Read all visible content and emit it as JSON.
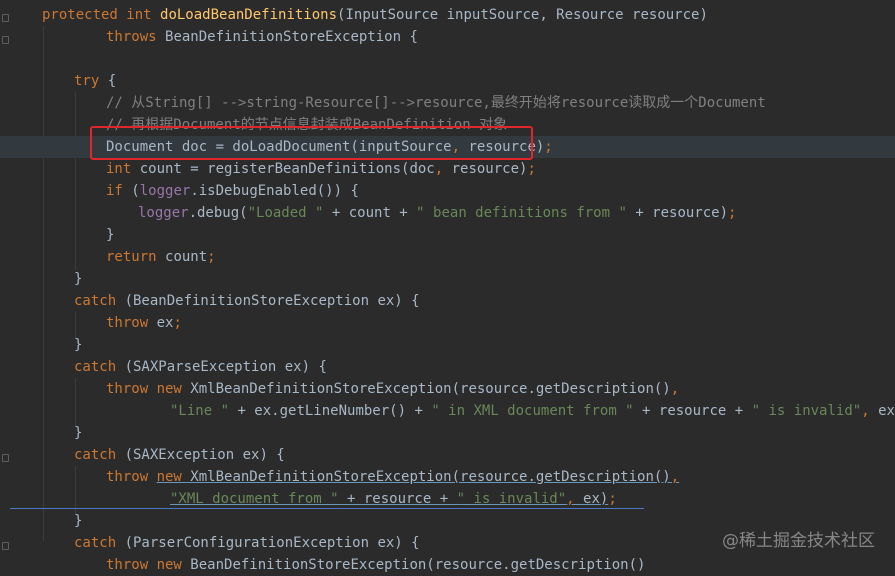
{
  "editor": {
    "lines": [
      {
        "indent": 42,
        "tokens": [
          {
            "t": "protected int ",
            "c": "kw"
          },
          {
            "t": "doLoadBeanDefinitions",
            "c": "fn"
          },
          {
            "t": "(InputSource inputSource, Resource resource)",
            "c": ""
          }
        ]
      },
      {
        "indent": 106,
        "tokens": [
          {
            "t": "throws ",
            "c": "kw"
          },
          {
            "t": "BeanDefinitionStoreException {",
            "c": ""
          }
        ]
      },
      {
        "indent": 0,
        "tokens": []
      },
      {
        "indent": 74,
        "tokens": [
          {
            "t": "try ",
            "c": "kw"
          },
          {
            "t": "{",
            "c": ""
          }
        ]
      },
      {
        "indent": 106,
        "tokens": [
          {
            "t": "// 从String[] -->string-Resource[]-->resource,最终开始将resource读取成一个Document",
            "c": "cmt"
          }
        ]
      },
      {
        "indent": 106,
        "tokens": [
          {
            "t": "// 再根据Document的节点信息封装成BeanDefinition 对象",
            "c": "cmt"
          }
        ]
      },
      {
        "indent": 106,
        "current": true,
        "tokens": [
          {
            "t": "Document doc = doLoadDocument(inputSource",
            "c": ""
          },
          {
            "t": ", ",
            "c": "kw"
          },
          {
            "t": "resource)",
            "c": ""
          },
          {
            "t": ";",
            "c": "kw"
          }
        ]
      },
      {
        "indent": 106,
        "tokens": [
          {
            "t": "int ",
            "c": "kw"
          },
          {
            "t": "count = registerBeanDefinitions(doc",
            "c": ""
          },
          {
            "t": ", ",
            "c": "kw"
          },
          {
            "t": "resource)",
            "c": ""
          },
          {
            "t": ";",
            "c": "kw"
          }
        ]
      },
      {
        "indent": 106,
        "tokens": [
          {
            "t": "if ",
            "c": "kw"
          },
          {
            "t": "(",
            "c": ""
          },
          {
            "t": "logger",
            "c": "fld"
          },
          {
            "t": ".isDebugEnabled()) {",
            "c": ""
          }
        ]
      },
      {
        "indent": 138,
        "tokens": [
          {
            "t": "logger",
            "c": "fld"
          },
          {
            "t": ".debug(",
            "c": ""
          },
          {
            "t": "\"Loaded \"",
            "c": "str"
          },
          {
            "t": " + count + ",
            "c": ""
          },
          {
            "t": "\" bean definitions from \"",
            "c": "str"
          },
          {
            "t": " + resource)",
            "c": ""
          },
          {
            "t": ";",
            "c": "kw"
          }
        ]
      },
      {
        "indent": 106,
        "tokens": [
          {
            "t": "}",
            "c": ""
          }
        ]
      },
      {
        "indent": 106,
        "tokens": [
          {
            "t": "return ",
            "c": "kw"
          },
          {
            "t": "count",
            "c": ""
          },
          {
            "t": ";",
            "c": "kw"
          }
        ]
      },
      {
        "indent": 74,
        "tokens": [
          {
            "t": "}",
            "c": ""
          }
        ]
      },
      {
        "indent": 74,
        "tokens": [
          {
            "t": "catch ",
            "c": "kw"
          },
          {
            "t": "(BeanDefinitionStoreException ex) {",
            "c": ""
          }
        ]
      },
      {
        "indent": 106,
        "tokens": [
          {
            "t": "throw ",
            "c": "kw"
          },
          {
            "t": "ex",
            "c": ""
          },
          {
            "t": ";",
            "c": "kw"
          }
        ]
      },
      {
        "indent": 74,
        "tokens": [
          {
            "t": "}",
            "c": ""
          }
        ]
      },
      {
        "indent": 74,
        "tokens": [
          {
            "t": "catch ",
            "c": "kw"
          },
          {
            "t": "(SAXParseException ex) {",
            "c": ""
          }
        ]
      },
      {
        "indent": 106,
        "tokens": [
          {
            "t": "throw new ",
            "c": "kw"
          },
          {
            "t": "XmlBeanDefinitionStoreException(resource.getDescription()",
            "c": ""
          },
          {
            "t": ",",
            "c": "kw"
          }
        ]
      },
      {
        "indent": 170,
        "tokens": [
          {
            "t": "\"Line \"",
            "c": "str"
          },
          {
            "t": " + ex.getLineNumber() + ",
            "c": ""
          },
          {
            "t": "\" in XML document from \"",
            "c": "str"
          },
          {
            "t": " + resource + ",
            "c": ""
          },
          {
            "t": "\" is invalid\"",
            "c": "str"
          },
          {
            "t": ", ",
            "c": "kw"
          },
          {
            "t": "ex)",
            "c": ""
          },
          {
            "t": ";",
            "c": "kw"
          }
        ]
      },
      {
        "indent": 74,
        "tokens": [
          {
            "t": "}",
            "c": ""
          }
        ]
      },
      {
        "indent": 74,
        "tokens": [
          {
            "t": "catch ",
            "c": "kw"
          },
          {
            "t": "(SAXException ex) {",
            "c": ""
          }
        ]
      },
      {
        "indent": 106,
        "tokens": [
          {
            "t": "throw ",
            "c": "kw"
          },
          {
            "t": "new ",
            "c": "kw link"
          },
          {
            "t": "XmlBeanDefinitionStoreException(resource.getDescription()",
            "c": "link"
          },
          {
            "t": ",",
            "c": "kw link"
          }
        ]
      },
      {
        "indent": 170,
        "tokens": [
          {
            "t": "\"XML document from \"",
            "c": "str link"
          },
          {
            "t": " + resource + ",
            "c": "link"
          },
          {
            "t": "\" is invalid\"",
            "c": "str link"
          },
          {
            "t": ", ",
            "c": "kw link"
          },
          {
            "t": "ex)",
            "c": "link"
          },
          {
            "t": ";",
            "c": "kw"
          }
        ]
      },
      {
        "indent": 74,
        "tokens": [
          {
            "t": "}",
            "c": ""
          }
        ]
      },
      {
        "indent": 74,
        "tokens": [
          {
            "t": "catch ",
            "c": "kw"
          },
          {
            "t": "(ParserConfigurationException ex) {",
            "c": ""
          }
        ]
      },
      {
        "indent": 106,
        "tokens": [
          {
            "t": "throw new ",
            "c": "kw"
          },
          {
            "t": "BeanDefinitionStoreException(resource.getDescription()",
            "c": ""
          }
        ]
      }
    ]
  },
  "watermark": "@稀土掘金技术社区",
  "colors": {
    "background": "#2b2b2b",
    "keyword": "#cc7832",
    "method": "#ffc66d",
    "string": "#6a8759",
    "comment": "#808080",
    "field": "#9876aa",
    "highlight_box": "#e0262b"
  }
}
